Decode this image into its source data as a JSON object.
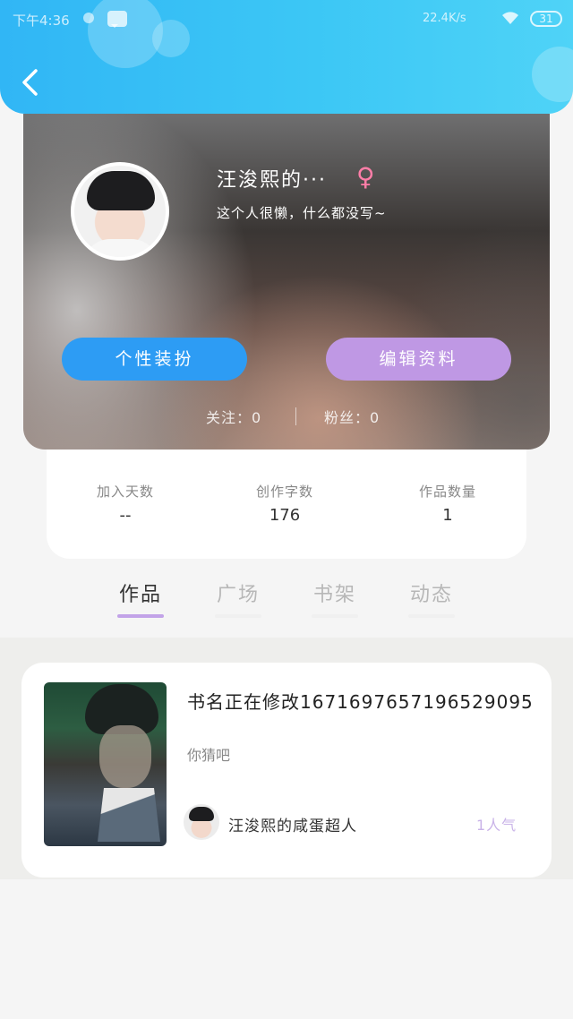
{
  "status_bar": {
    "time": "下午4:36",
    "network_speed": "22.4K/s",
    "battery": "31"
  },
  "header": {
    "back_icon": "chevron-left-icon"
  },
  "profile": {
    "username": "汪浚熙的···",
    "gender_icon": "♀",
    "bio": "这个人很懒，什么都没写~",
    "dress_button": "个性装扮",
    "edit_button": "编辑资料",
    "following": "关注：0",
    "followers": "粉丝：0"
  },
  "stats": [
    {
      "label": "加入天数",
      "value": "--"
    },
    {
      "label": "创作字数",
      "value": "176"
    },
    {
      "label": "作品数量",
      "value": "1"
    }
  ],
  "tabs": [
    {
      "label": "作品",
      "active": true
    },
    {
      "label": "广场",
      "active": false
    },
    {
      "label": "书架",
      "active": false
    },
    {
      "label": "动态",
      "active": false
    }
  ],
  "work": {
    "title": "书名正在修改1671697657196529095",
    "description": "你猜吧",
    "author": "汪浚熙的咸蛋超人",
    "popularity": "1人气"
  },
  "colors": {
    "header": "#3cc7f5",
    "dress_button": "#2d9cf4",
    "edit_button": "#bf98e4",
    "tab_underline_active": "#c2a3e8",
    "tab_underline_inactive": "#f0f0f0",
    "popularity": "#c9b3e8"
  }
}
